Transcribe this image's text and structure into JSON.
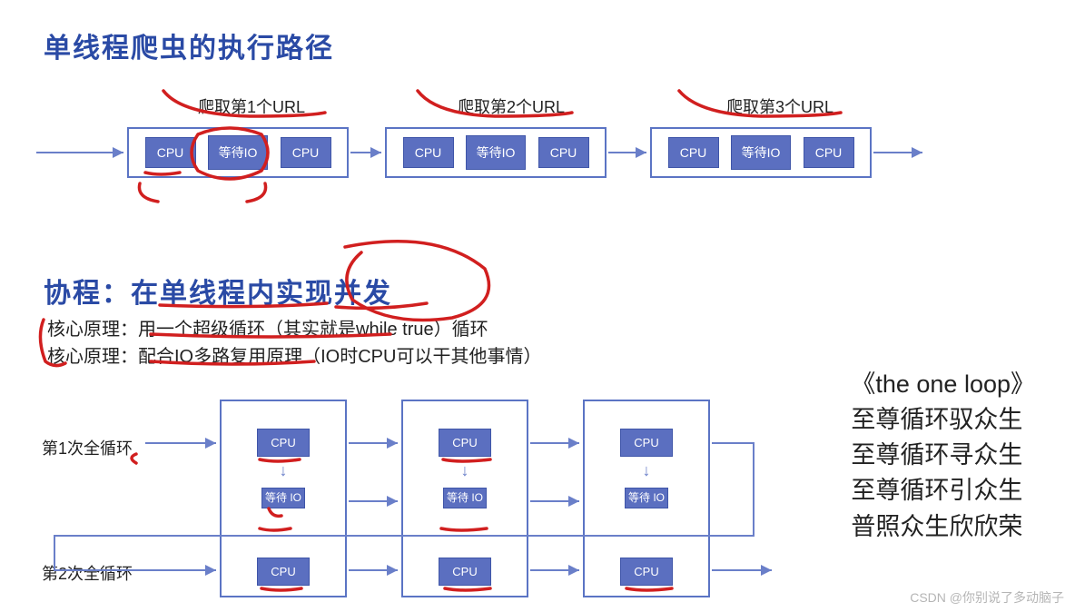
{
  "top": {
    "title": "单线程爬虫的执行路径",
    "urls": [
      {
        "label": "爬取第1个URL",
        "chips": [
          "CPU",
          "等待IO",
          "CPU"
        ]
      },
      {
        "label": "爬取第2个URL",
        "chips": [
          "CPU",
          "等待IO",
          "CPU"
        ]
      },
      {
        "label": "爬取第3个URL",
        "chips": [
          "CPU",
          "等待IO",
          "CPU"
        ]
      }
    ]
  },
  "mid": {
    "title": "协程：在单线程内实现并发",
    "sub1_label": "核心原理：",
    "sub1_text": "用一个超级循环（其实就是while true）循环",
    "sub2_label": "核心原理：",
    "sub2_text": "配合IO多路复用原理（IO时CPU可以干其他事情）"
  },
  "loops": {
    "row1_label": "第1次全循环",
    "row2_label": "第2次全循环",
    "cols": [
      {
        "cpu_a": "CPU",
        "io": "等待\nIO",
        "cpu_b": "CPU"
      },
      {
        "cpu_a": "CPU",
        "io": "等待\nIO",
        "cpu_b": "CPU"
      },
      {
        "cpu_a": "CPU",
        "io": "等待\nIO",
        "cpu_b": "CPU"
      }
    ]
  },
  "poem": {
    "l1": "《the one loop》",
    "l2": "至尊循环驭众生",
    "l3": "至尊循环寻众生",
    "l4": "至尊循环引众生",
    "l5": "普照众生欣欣荣"
  },
  "watermark": "CSDN @你别说了多动脑子"
}
